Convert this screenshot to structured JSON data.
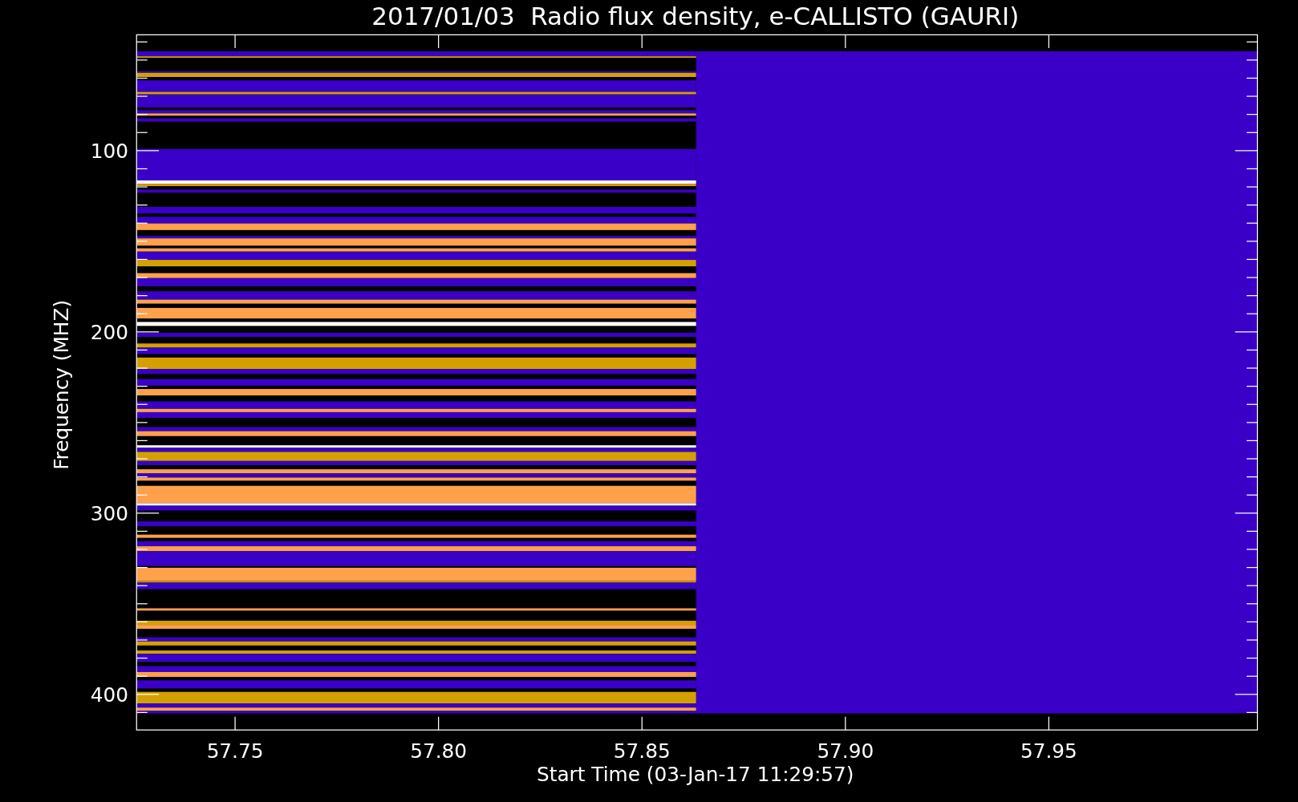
{
  "title": "2017/01/03  Radio flux density, e-CALLISTO (GAURI)",
  "x_axis": {
    "label": "Start Time (03-Jan-17 11:29:57)",
    "ticks": [
      "57.75",
      "57.80",
      "57.85",
      "57.90",
      "57.95"
    ]
  },
  "y_axis": {
    "label": "Frequency (MHZ)",
    "ticks": [
      "100",
      "200",
      "300",
      "400"
    ]
  }
}
